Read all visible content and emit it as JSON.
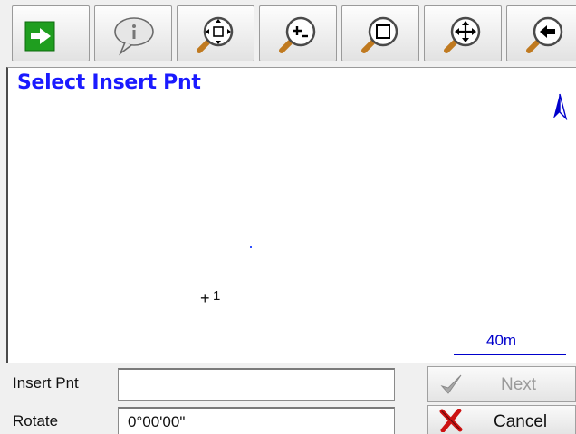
{
  "toolbar": {
    "buttons": [
      {
        "name": "accept-arrow",
        "icon": "green-arrow-right-icon"
      },
      {
        "name": "info",
        "icon": "info-speech-bubble-icon"
      },
      {
        "name": "zoom-extents",
        "icon": "zoom-extents-icon"
      },
      {
        "name": "zoom-in-out",
        "icon": "zoom-in-out-icon"
      },
      {
        "name": "zoom-window",
        "icon": "zoom-window-icon"
      },
      {
        "name": "pan",
        "icon": "pan-icon"
      },
      {
        "name": "previous-view",
        "icon": "previous-view-icon"
      }
    ]
  },
  "map": {
    "title": "Select Insert Pnt",
    "point_label": "1",
    "scale_label": "40m"
  },
  "form": {
    "insert_label": "Insert Pnt",
    "insert_value": "",
    "rotate_label": "Rotate",
    "rotate_value": "0°00'00\""
  },
  "actions": {
    "next_label": "Next",
    "cancel_label": "Cancel"
  },
  "colors": {
    "title": "#1a1aff",
    "scale": "#0000cc",
    "accept_green": "#1f9e1f",
    "cancel_red": "#cc1111",
    "disabled": "#9a9a9a"
  }
}
